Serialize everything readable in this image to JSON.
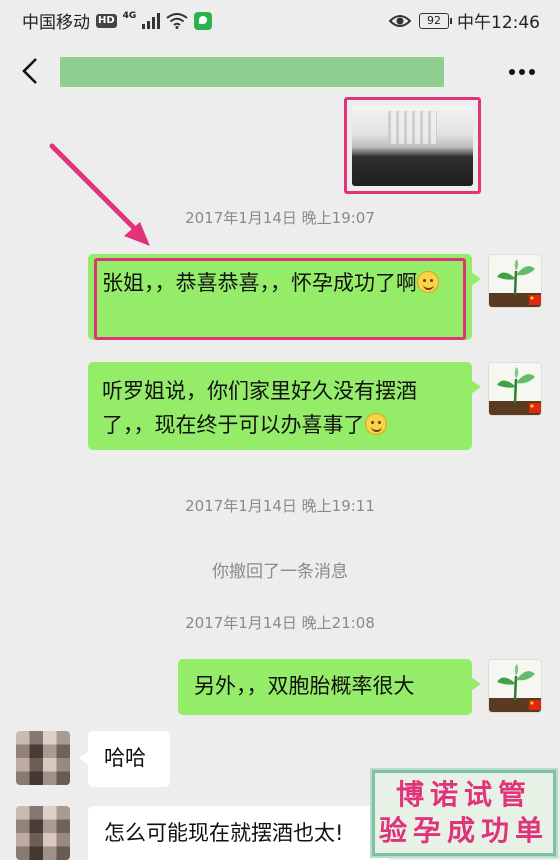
{
  "status_bar": {
    "carrier": "中国移动",
    "hd_badge": "HD",
    "network": "4G",
    "battery": "92",
    "time": "中午12:46"
  },
  "header": {
    "back_icon": "chevron-left-icon",
    "more_icon": "ellipsis-icon"
  },
  "messages": [
    {
      "type": "image",
      "from": "me"
    },
    {
      "type": "timestamp",
      "text": "2017年1月14日 晚上19:07"
    },
    {
      "type": "text",
      "from": "me",
      "text": "张姐，，恭喜恭喜，，怀孕成功了啊"
    },
    {
      "type": "text",
      "from": "me",
      "text": "听罗姐说，你们家里好久没有摆酒了，，现在终于可以办喜事了"
    },
    {
      "type": "timestamp",
      "text": "2017年1月14日 晚上19:11"
    },
    {
      "type": "system",
      "text": "你撤回了一条消息"
    },
    {
      "type": "timestamp",
      "text": "2017年1月14日 晚上21:08"
    },
    {
      "type": "text",
      "from": "me",
      "text": "另外，，双胞胎概率很大"
    },
    {
      "type": "text",
      "from": "other",
      "text": "哈哈"
    },
    {
      "type": "text",
      "from": "other",
      "text": "怎么可能现在就摆酒也太!"
    }
  ],
  "watermark": {
    "line1": "博诺试管",
    "line2": "验孕成功单"
  },
  "colors": {
    "outgoing_bubble": "#95ec69",
    "incoming_bubble": "#ffffff",
    "highlight": "#e0337a",
    "background": "#ededed"
  }
}
